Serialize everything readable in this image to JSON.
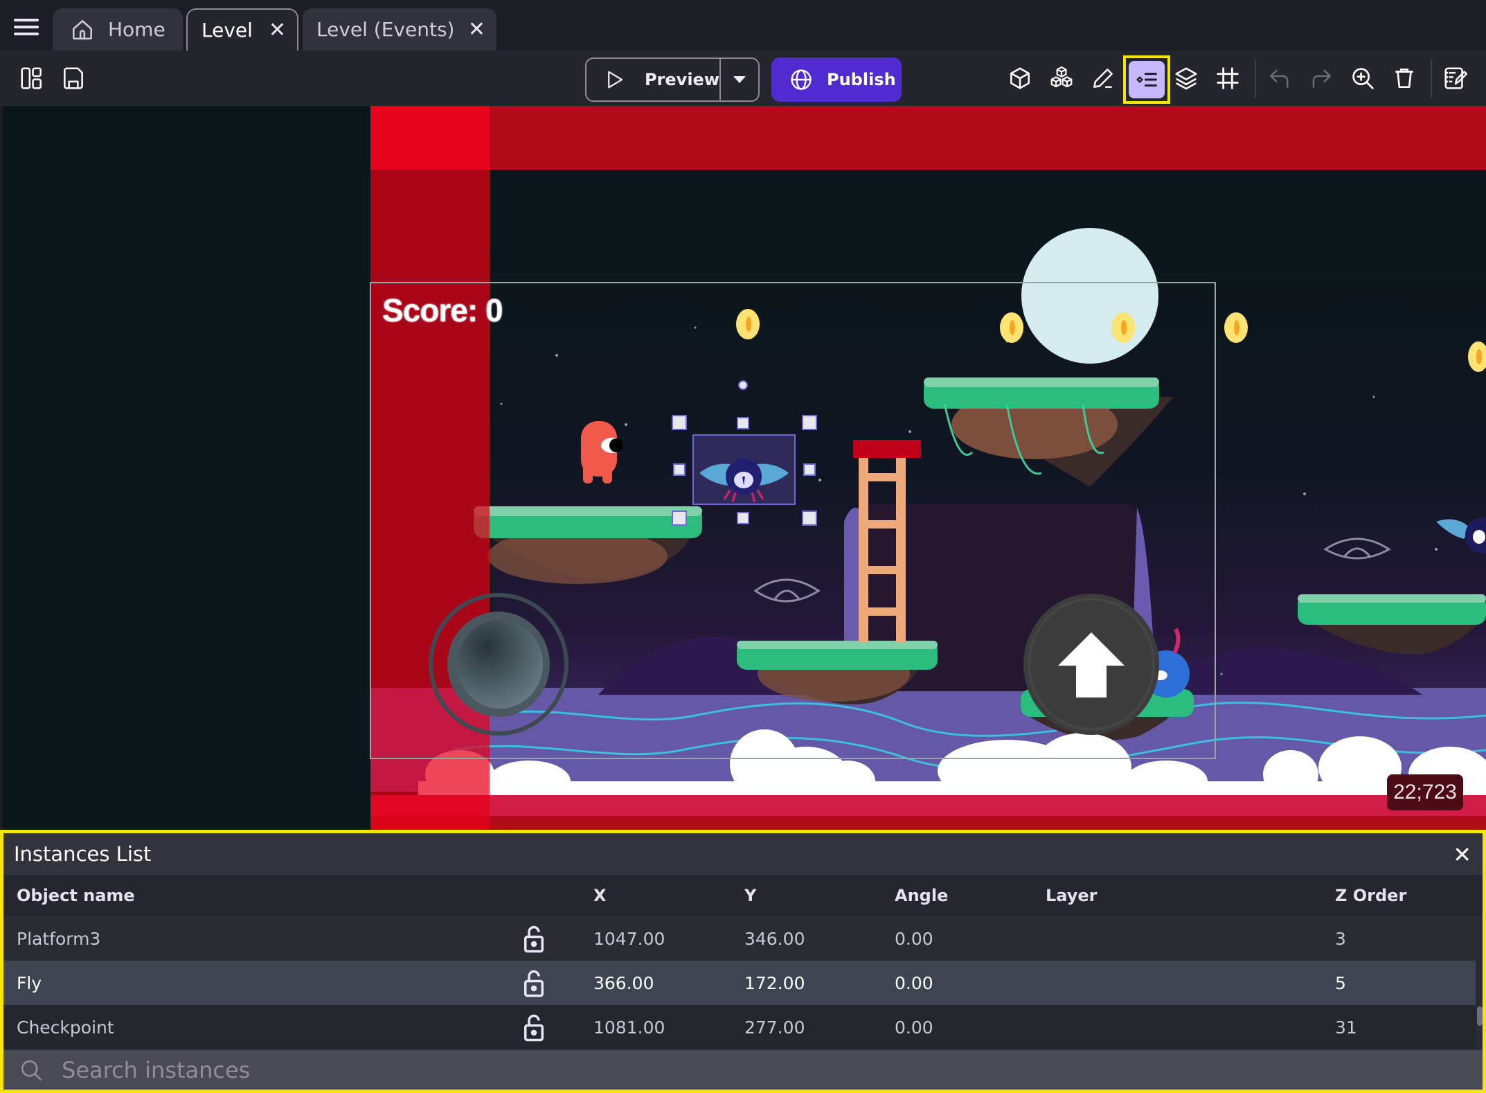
{
  "tabs": [
    {
      "label": "Home",
      "icon": "home-icon",
      "active": false,
      "closable": false
    },
    {
      "label": "Level",
      "active": true,
      "closable": true
    },
    {
      "label": "Level (Events)",
      "active": false,
      "closable": true
    }
  ],
  "tab_close_glyph": "✕",
  "toolbar": {
    "left_icons": [
      "panels-icon",
      "save-icon"
    ],
    "preview_label": "Preview",
    "publish_label": "Publish",
    "right_icons": [
      "objects-cube-icon",
      "object-groups-icon",
      "properties-pencil-icon",
      "instances-list-icon",
      "layers-icon",
      "grid-icon",
      "undo-icon",
      "redo-icon",
      "zoom-in-icon",
      "delete-icon",
      "scene-edit-icon"
    ],
    "active_icon": "instances-list-icon"
  },
  "canvas": {
    "score_text": "Score: 0",
    "cursor_coords": "22;723",
    "selected_object": "Fly"
  },
  "instances_panel": {
    "title": "Instances List",
    "close_glyph": "✕",
    "columns": [
      "Object name",
      "",
      "X",
      "Y",
      "Angle",
      "Layer",
      "Z Order"
    ],
    "rows": [
      {
        "name": "Platform3",
        "locked": false,
        "x": "1047.00",
        "y": "346.00",
        "angle": "0.00",
        "layer": "",
        "z": "3",
        "selected": false
      },
      {
        "name": "Fly",
        "locked": false,
        "x": "366.00",
        "y": "172.00",
        "angle": "0.00",
        "layer": "",
        "z": "5",
        "selected": true
      },
      {
        "name": "Checkpoint",
        "locked": false,
        "x": "1081.00",
        "y": "277.00",
        "angle": "0.00",
        "layer": "",
        "z": "31",
        "selected": false
      }
    ],
    "search_placeholder": "Search instances",
    "search_value": ""
  },
  "colors": {
    "accent_publish": "#4f2bd1",
    "highlight": "#f5e600",
    "active_toggle": "#c7b7fb"
  }
}
